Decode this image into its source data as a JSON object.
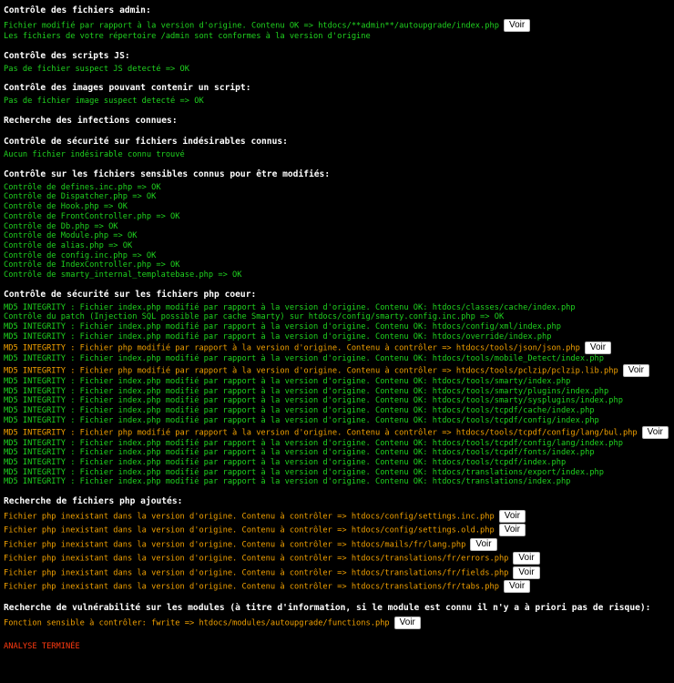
{
  "button_label": "Voir",
  "colors": {
    "ok": "#1fd31f",
    "warn": "#f0a000",
    "done": "#ff3a10",
    "heading": "#ffffff"
  },
  "admin": {
    "title": "Contrôle des fichiers admin:",
    "lines": [
      {
        "text": "Fichier modifié par rapport à la version d'origine. Contenu OK => htdocs/**admin**/autoupgrade/index.php",
        "status": "ok",
        "button": true
      },
      {
        "text": "Les fichiers de votre répertoire /admin sont conformes à la version d'origine",
        "status": "ok",
        "button": false
      }
    ]
  },
  "js": {
    "title": "Contrôle des scripts JS:",
    "lines": [
      {
        "text": "Pas de fichier suspect JS detecté => OK",
        "status": "ok",
        "button": false
      }
    ]
  },
  "images": {
    "title": "Contrôle des images pouvant contenir un script:",
    "lines": [
      {
        "text": "Pas de fichier image suspect detecté => OK",
        "status": "ok",
        "button": false
      }
    ]
  },
  "infections": {
    "title": "Recherche des infections connues:",
    "lines": []
  },
  "undesirable": {
    "title": "Contrôle de sécurité sur fichiers indésirables connus:",
    "lines": [
      {
        "text": "Aucun fichier indésirable connu trouvé",
        "status": "ok",
        "button": false
      }
    ]
  },
  "sensitive": {
    "title": "Contrôle sur les fichiers sensibles connus pour être modifiés:",
    "lines": [
      {
        "text": "Contrôle de defines.inc.php => OK",
        "status": "ok",
        "button": false
      },
      {
        "text": "Contrôle de Dispatcher.php => OK",
        "status": "ok",
        "button": false
      },
      {
        "text": "Contrôle de Hook.php => OK",
        "status": "ok",
        "button": false
      },
      {
        "text": "Contrôle de FrontController.php => OK",
        "status": "ok",
        "button": false
      },
      {
        "text": "Contrôle de Db.php => OK",
        "status": "ok",
        "button": false
      },
      {
        "text": "Contrôle de Module.php => OK",
        "status": "ok",
        "button": false
      },
      {
        "text": "Contrôle de alias.php => OK",
        "status": "ok",
        "button": false
      },
      {
        "text": "Contrôle de config.inc.php => OK",
        "status": "ok",
        "button": false
      },
      {
        "text": "Contrôle de IndexController.php => OK",
        "status": "ok",
        "button": false
      },
      {
        "text": "Contrôle de smarty_internal_templatebase.php => OK",
        "status": "ok",
        "button": false
      }
    ]
  },
  "core": {
    "title": "Contrôle de sécurité sur les fichiers php coeur:",
    "lines": [
      {
        "text": "MD5 INTEGRITY : Fichier index.php modifié par rapport à la version d'origine. Contenu OK: htdocs/classes/cache/index.php",
        "status": "ok",
        "button": false
      },
      {
        "text": "Contrôle du patch (Injection SQL possible par cache Smarty) sur htdocs/config/smarty.config.inc.php => OK",
        "status": "ok",
        "button": false
      },
      {
        "text": "MD5 INTEGRITY : Fichier index.php modifié par rapport à la version d'origine. Contenu OK: htdocs/config/xml/index.php",
        "status": "ok",
        "button": false
      },
      {
        "text": "MD5 INTEGRITY : Fichier index.php modifié par rapport à la version d'origine. Contenu OK: htdocs/override/index.php",
        "status": "ok",
        "button": false
      },
      {
        "text": "MD5 INTEGRITY : Fichier php modifié par rapport à la version d'origine. Contenu à contrôler => htdocs/tools/json/json.php",
        "status": "warn",
        "button": true
      },
      {
        "text": "MD5 INTEGRITY : Fichier index.php modifié par rapport à la version d'origine. Contenu OK: htdocs/tools/mobile_Detect/index.php",
        "status": "ok",
        "button": false
      },
      {
        "text": "MD5 INTEGRITY : Fichier php modifié par rapport à la version d'origine. Contenu à contrôler => htdocs/tools/pclzip/pclzip.lib.php",
        "status": "warn",
        "button": true
      },
      {
        "text": "MD5 INTEGRITY : Fichier index.php modifié par rapport à la version d'origine. Contenu OK: htdocs/tools/smarty/index.php",
        "status": "ok",
        "button": false
      },
      {
        "text": "MD5 INTEGRITY : Fichier index.php modifié par rapport à la version d'origine. Contenu OK: htdocs/tools/smarty/plugins/index.php",
        "status": "ok",
        "button": false
      },
      {
        "text": "MD5 INTEGRITY : Fichier index.php modifié par rapport à la version d'origine. Contenu OK: htdocs/tools/smarty/sysplugins/index.php",
        "status": "ok",
        "button": false
      },
      {
        "text": "MD5 INTEGRITY : Fichier index.php modifié par rapport à la version d'origine. Contenu OK: htdocs/tools/tcpdf/cache/index.php",
        "status": "ok",
        "button": false
      },
      {
        "text": "MD5 INTEGRITY : Fichier index.php modifié par rapport à la version d'origine. Contenu OK: htdocs/tools/tcpdf/config/index.php",
        "status": "ok",
        "button": false
      },
      {
        "text": "MD5 INTEGRITY : Fichier php modifié par rapport à la version d'origine. Contenu à contrôler => htdocs/tools/tcpdf/config/lang/bul.php",
        "status": "warn",
        "button": true
      },
      {
        "text": "MD5 INTEGRITY : Fichier index.php modifié par rapport à la version d'origine. Contenu OK: htdocs/tools/tcpdf/config/lang/index.php",
        "status": "ok",
        "button": false
      },
      {
        "text": "MD5 INTEGRITY : Fichier index.php modifié par rapport à la version d'origine. Contenu OK: htdocs/tools/tcpdf/fonts/index.php",
        "status": "ok",
        "button": false
      },
      {
        "text": "MD5 INTEGRITY : Fichier index.php modifié par rapport à la version d'origine. Contenu OK: htdocs/tools/tcpdf/index.php",
        "status": "ok",
        "button": false
      },
      {
        "text": "MD5 INTEGRITY : Fichier index.php modifié par rapport à la version d'origine. Contenu OK: htdocs/translations/export/index.php",
        "status": "ok",
        "button": false
      },
      {
        "text": "MD5 INTEGRITY : Fichier index.php modifié par rapport à la version d'origine. Contenu OK: htdocs/translations/index.php",
        "status": "ok",
        "button": false
      }
    ]
  },
  "added": {
    "title": "Recherche de fichiers php ajoutés:",
    "lines": [
      {
        "text": "Fichier php inexistant dans la version d'origine. Contenu à contrôler => htdocs/config/settings.inc.php",
        "status": "warn",
        "button": true
      },
      {
        "text": "Fichier php inexistant dans la version d'origine. Contenu à contrôler => htdocs/config/settings.old.php",
        "status": "warn",
        "button": true
      },
      {
        "text": "Fichier php inexistant dans la version d'origine. Contenu à contrôler => htdocs/mails/fr/lang.php",
        "status": "warn",
        "button": true
      },
      {
        "text": "Fichier php inexistant dans la version d'origine. Contenu à contrôler => htdocs/translations/fr/errors.php",
        "status": "warn",
        "button": true
      },
      {
        "text": "Fichier php inexistant dans la version d'origine. Contenu à contrôler => htdocs/translations/fr/fields.php",
        "status": "warn",
        "button": true
      },
      {
        "text": "Fichier php inexistant dans la version d'origine. Contenu à contrôler => htdocs/translations/fr/tabs.php",
        "status": "warn",
        "button": true
      }
    ]
  },
  "modules": {
    "title": "Recherche de vulnérabilité sur les modules (à titre d'information, si le module est connu il n'y a à priori pas de risque):",
    "lines": [
      {
        "text": "Fonction sensible à contrôler: fwrite => htdocs/modules/autoupgrade/functions.php",
        "status": "warn",
        "button": true
      }
    ]
  },
  "footer": {
    "status": "ANALYSE TERMINÉE"
  }
}
